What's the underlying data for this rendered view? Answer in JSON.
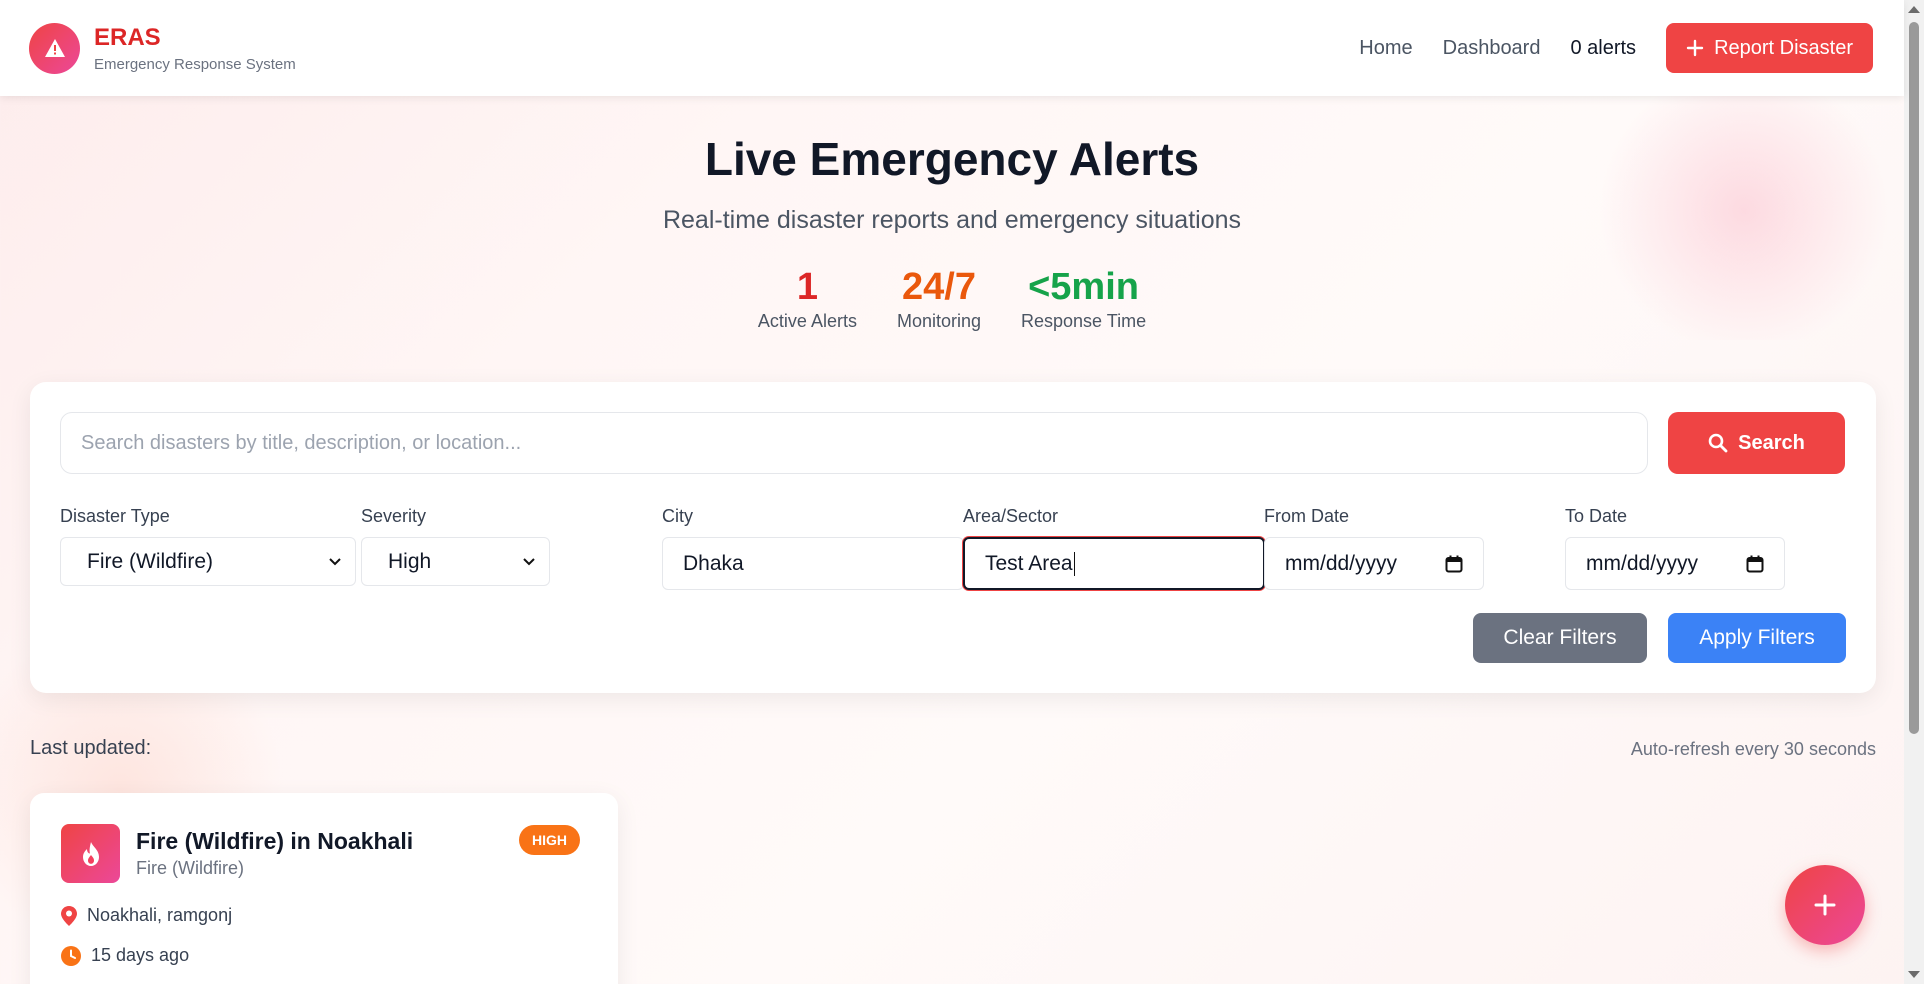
{
  "brand": {
    "name": "ERAS",
    "subtitle": "Emergency Response System",
    "logo_icon": "warning-triangle-icon"
  },
  "nav": {
    "home": "Home",
    "dashboard": "Dashboard",
    "alerts": "0 alerts",
    "report_button": "Report Disaster"
  },
  "hero": {
    "title": "Live Emergency Alerts",
    "subtitle": "Real-time disaster reports and emergency situations"
  },
  "stats": [
    {
      "value": "1",
      "label": "Active Alerts",
      "color": "#dc2626"
    },
    {
      "value": "24/7",
      "label": "Monitoring",
      "color": "#ea580c"
    },
    {
      "value": "<5min",
      "label": "Response Time",
      "color": "#16a34a"
    }
  ],
  "search": {
    "placeholder": "Search disasters by title, description, or location...",
    "value": "",
    "button": "Search"
  },
  "filters": {
    "disaster_type": {
      "label": "Disaster Type",
      "value": "Fire (Wildfire)"
    },
    "severity": {
      "label": "Severity",
      "value": "High"
    },
    "city": {
      "label": "City",
      "value": "Dhaka"
    },
    "area": {
      "label": "Area/Sector",
      "value": "Test Area"
    },
    "from_date": {
      "label": "From Date",
      "value": "mm/dd/yyyy"
    },
    "to_date": {
      "label": "To Date",
      "value": "mm/dd/yyyy"
    },
    "clear_button": "Clear Filters",
    "apply_button": "Apply Filters"
  },
  "status": {
    "last_updated": "Last updated:",
    "auto_refresh": "Auto-refresh every 30 seconds"
  },
  "alerts": [
    {
      "title": "Fire (Wildfire) in Noakhali",
      "type": "Fire (Wildfire)",
      "severity": "HIGH",
      "location": "Noakhali, ramgonj",
      "time": "15 days ago",
      "icon": "flame-icon"
    }
  ],
  "colors": {
    "accent": "#ef4444",
    "apply": "#3b82f6",
    "clear": "#6b7280",
    "severity_high": "#f97316"
  }
}
